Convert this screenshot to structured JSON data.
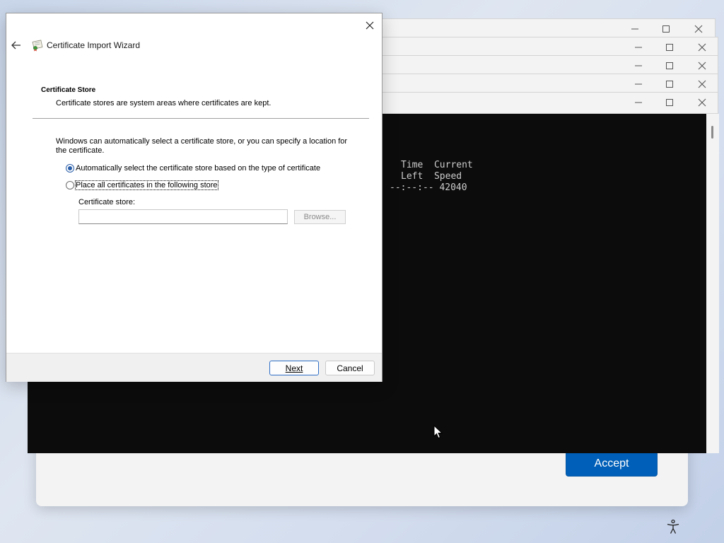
{
  "wizard": {
    "title": "Certificate Import Wizard",
    "section_heading": "Certificate Store",
    "section_subtitle": "Certificate stores are system areas where certificates are kept.",
    "intro_text": "Windows can automatically select a certificate store, or you can specify a location for the certificate.",
    "radio_auto_label": "Automatically select the certificate store based on the type of certificate",
    "radio_auto_selected": true,
    "radio_place_label": "Place all certificates in the following store",
    "store_label": "Certificate store:",
    "store_value": "",
    "browse_label": "Browse...",
    "next_label": "Next",
    "cancel_label": "Cancel"
  },
  "terminal": {
    "lines": [
      "Time  Current",
      "Left  Speed",
      "--:--:-- 42040"
    ]
  },
  "background_dialog": {
    "accept_label": "Accept"
  },
  "colors": {
    "accent": "#005fb8",
    "terminal_bg": "#0c0c0c",
    "terminal_fg": "#cccccc"
  },
  "icons": {
    "back": "arrow-left-icon",
    "wizard": "certificate-icon",
    "close": "close-icon",
    "minimize": "minimize-icon",
    "maximize": "maximize-icon",
    "accessibility": "accessibility-icon"
  }
}
